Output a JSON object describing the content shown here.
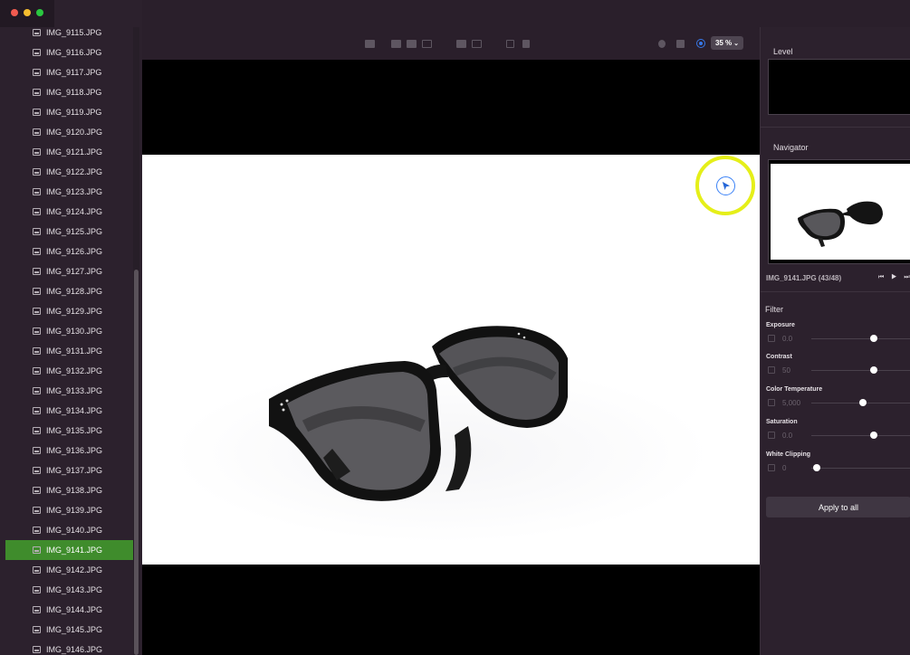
{
  "sidebar": {
    "files": [
      "IMG_9115.JPG",
      "IMG_9116.JPG",
      "IMG_9117.JPG",
      "IMG_9118.JPG",
      "IMG_9119.JPG",
      "IMG_9120.JPG",
      "IMG_9121.JPG",
      "IMG_9122.JPG",
      "IMG_9123.JPG",
      "IMG_9124.JPG",
      "IMG_9125.JPG",
      "IMG_9126.JPG",
      "IMG_9127.JPG",
      "IMG_9128.JPG",
      "IMG_9129.JPG",
      "IMG_9130.JPG",
      "IMG_9131.JPG",
      "IMG_9132.JPG",
      "IMG_9133.JPG",
      "IMG_9134.JPG",
      "IMG_9135.JPG",
      "IMG_9136.JPG",
      "IMG_9137.JPG",
      "IMG_9138.JPG",
      "IMG_9139.JPG",
      "IMG_9140.JPG",
      "IMG_9141.JPG",
      "IMG_9142.JPG",
      "IMG_9143.JPG",
      "IMG_9144.JPG",
      "IMG_9145.JPG",
      "IMG_9146.JPG"
    ],
    "selected_file": "IMG_9141.JPG",
    "selection_color": "#3f8c2c"
  },
  "toolbar": {
    "zoom_label": "35 %",
    "zoom_chevron": "⌄"
  },
  "panel": {
    "level_title": "Level",
    "navigator_title": "Navigator",
    "navigator_caption": "IMG_9141.JPG (43/48)",
    "navigator_controls": "⏮ ▶ ⏭",
    "filter_title": "Filter",
    "filters": [
      {
        "name": "Exposure",
        "value": "0.0",
        "level": 0.63
      },
      {
        "name": "Contrast",
        "value": "50",
        "level": 0.63
      },
      {
        "name": "Color Temperature",
        "value": "5,000",
        "level": 0.52
      },
      {
        "name": "Saturation",
        "value": "0.0",
        "level": 0.63
      },
      {
        "name": "White Clipping",
        "value": "0",
        "level": 0.05
      }
    ],
    "apply_label": "Apply to all"
  },
  "colors": {
    "cursor_highlight": "#e5ef19",
    "accent_blue": "#3778e8"
  }
}
